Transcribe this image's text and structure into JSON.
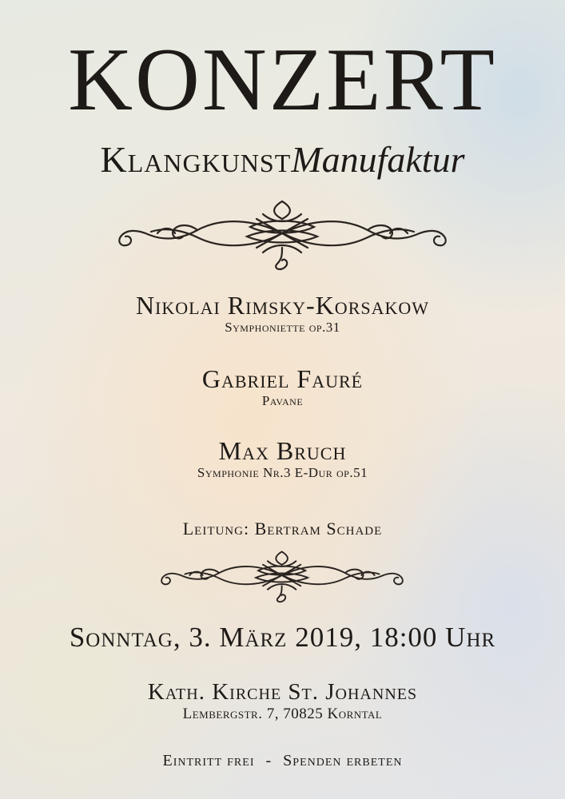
{
  "poster": {
    "title": "KONZERT",
    "ensemble": {
      "name_caps": "Klangkunst",
      "name_italic": "Manufaktur"
    },
    "program": [
      {
        "composer": "Nikolai Rimsky-Korsakow",
        "work": "Symphoniette op.31"
      },
      {
        "composer": "Gabriel Fauré",
        "work": "Pavane"
      },
      {
        "composer": "Max Bruch",
        "work": "Symphonie Nr.3 E-Dur op.51"
      }
    ],
    "conductor": "Leitung: Bertram Schade",
    "datetime": "Sonntag, 3. März 2019, 18:00 Uhr",
    "venue": "Kath. Kirche St. Johannes",
    "address": "Lembergstr. 7, 70825 Korntal",
    "footer": {
      "left": "Eintritt frei",
      "separator": "-",
      "right": "Spenden erbeten"
    },
    "ornaments": [
      "flourish-ornament",
      "flourish-ornament"
    ],
    "colors": {
      "ink": "#1e1a17",
      "background": "#ece6dc"
    }
  }
}
